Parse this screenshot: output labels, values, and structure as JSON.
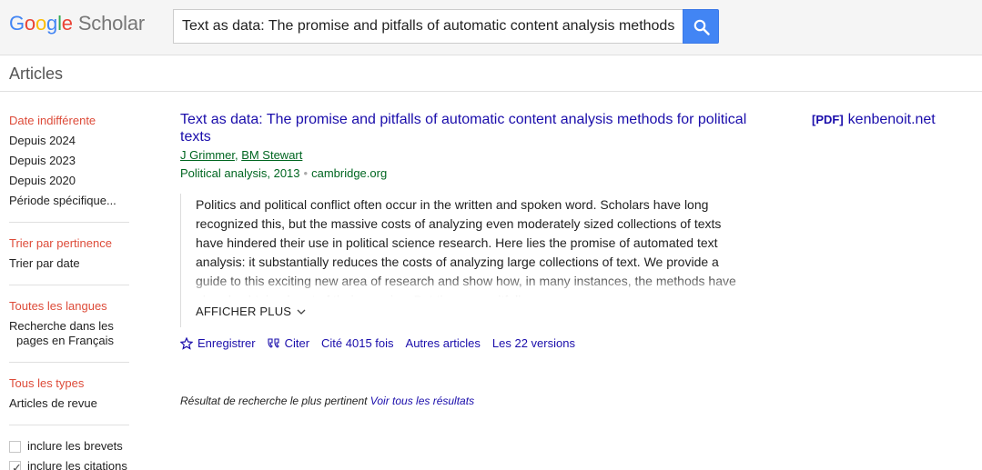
{
  "header": {
    "logo_parts": [
      "G",
      "o",
      "o",
      "g",
      "l",
      "e"
    ],
    "logo_scholar": "Scholar",
    "search_value": "Text as data: The promise and pitfalls of automatic content analysis methods"
  },
  "subbar": {
    "title": "Articles"
  },
  "sidebar": {
    "date_items": [
      "Date indifférente",
      "Depuis 2024",
      "Depuis 2023",
      "Depuis 2020",
      "Période spécifique..."
    ],
    "sort_items": [
      "Trier par pertinence",
      "Trier par date"
    ],
    "lang_items": [
      "Toutes les langues",
      "Recherche dans les",
      "pages en Français"
    ],
    "type_items": [
      "Tous les types",
      "Articles de revue"
    ],
    "checks": [
      {
        "label": "inclure les brevets",
        "checked": false
      },
      {
        "label": "inclure les citations",
        "checked": true
      }
    ]
  },
  "result": {
    "title": "Text as data: The promise and pitfalls of automatic content analysis methods for political texts",
    "author1": "J Grimmer",
    "author2": "BM Stewart",
    "author_sep": ", ",
    "journal": "Political analysis, 2013",
    "dot": "•",
    "source": "cambridge.org",
    "abstract": "Politics and political conflict often occur in the written and spoken word. Scholars have long recognized this, but the massive costs of analyzing even moderately sized collections of texts have hindered their use in political science research. Here lies the promise of automated text analysis: it substantially reduces the costs of analyzing large collections of text. We provide a guide to this exciting new area of research and show how, in many instances, the methods have already obtained part of their promise. But there are pitfalls",
    "show_more": "AFFICHER PLUS",
    "actions": {
      "save": "Enregistrer",
      "cite": "Citer",
      "cited_by": "Cité 4015 fois",
      "related": "Autres articles",
      "versions": "Les 22 versions"
    }
  },
  "pdf": {
    "tag": "[PDF]",
    "domain": "kenbenoit.net"
  },
  "footer": {
    "note": "Résultat de recherche le plus pertinent",
    "see_all": "Voir tous les résultats"
  }
}
